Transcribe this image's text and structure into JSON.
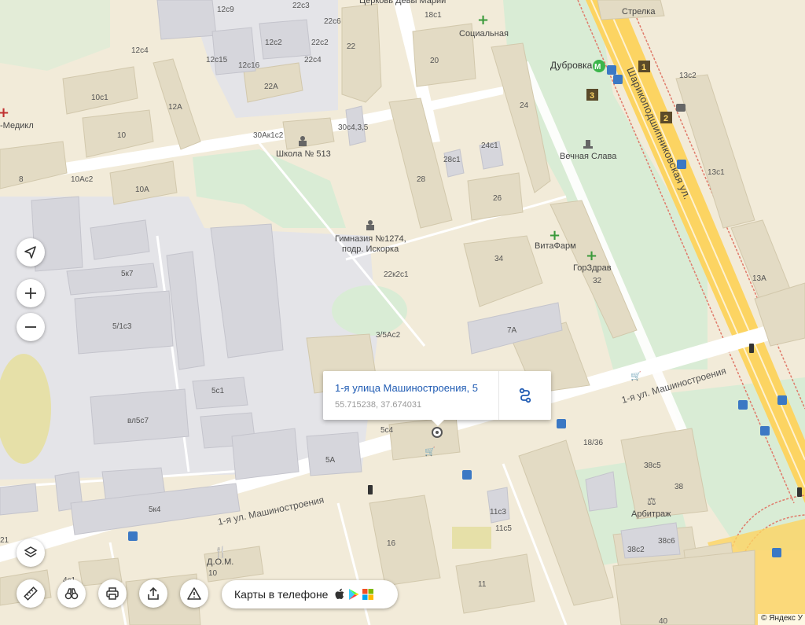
{
  "streets": {
    "mashinostroeniya_bottom": "1-я ул. Машиностроения",
    "mashinostroeniya_right": "1-я ул. Машиностроения",
    "sharikopodshipnikovskaya": "Шарикоподшипниковская ул."
  },
  "metro": {
    "station": "Дубровка",
    "exits": [
      "1",
      "2",
      "3"
    ]
  },
  "pois": {
    "school": "Школа № 513",
    "gymnasium": "Гимназия №1274,\nподр. Искорка",
    "gymnasium_line1": "Гимназия №1274,",
    "gymnasium_line2": "подр. Искорка",
    "socialnaya": "Социальная",
    "church": "Церковь Девы Марии",
    "strelka": "Стрелка",
    "vechnaya_slava": "Вечная Слава",
    "vitafarm": "ВитаФарм",
    "gorzdrav": "ГорЗдрав",
    "arbitrazh": "Арбитраж",
    "dom": "Д.О.М.",
    "medikl": "-Медикл"
  },
  "buildings": [
    "12с9",
    "22с3",
    "22с6",
    "18с1",
    "12с4",
    "12с2",
    "22с2",
    "22",
    "12с15",
    "12с16",
    "22с4",
    "20",
    "10с1",
    "22А",
    "12А",
    "24",
    "13с2",
    "30Ак1с2",
    "30с4,3,5",
    "10",
    "28с1",
    "24с1",
    "13с1",
    "8",
    "10Ас2",
    "28",
    "10А",
    "26",
    "5к7",
    "34",
    "22к2с1",
    "5/1с3",
    "13А",
    "3/5Ас2",
    "7А",
    "5с1",
    "вл5с7",
    "5с4",
    "18/36",
    "5А",
    "38с5",
    "38",
    "5к4",
    "11с3",
    "11с5",
    "21",
    "16",
    "10",
    "38с2",
    "38с6",
    "4с1",
    "11",
    "40",
    "32"
  ],
  "popup": {
    "title": "1-я улица Машиностроения, 5",
    "coords": "55.715238, 37.674031"
  },
  "controls": {
    "locate": "location-arrow-icon",
    "zoom_in": "plus-icon",
    "zoom_out": "minus-icon",
    "layers": "layers-icon",
    "ruler": "ruler-icon",
    "panorama": "binoculars-icon",
    "print": "printer-icon",
    "share": "share-icon",
    "report": "warning-icon"
  },
  "promo": {
    "label": "Карты в телефоне"
  },
  "copyright": "© Яндекс У",
  "colors": {
    "land": "#f2ebd9",
    "park": "#d9ecd5",
    "building": "#e3dbc4",
    "building_grey": "#d6d6dc",
    "industrial": "#e4e4e8",
    "road": "#ffffff",
    "major_road": "#fcd462",
    "link": "#1f5bb3",
    "railway": "#e07a6a"
  }
}
